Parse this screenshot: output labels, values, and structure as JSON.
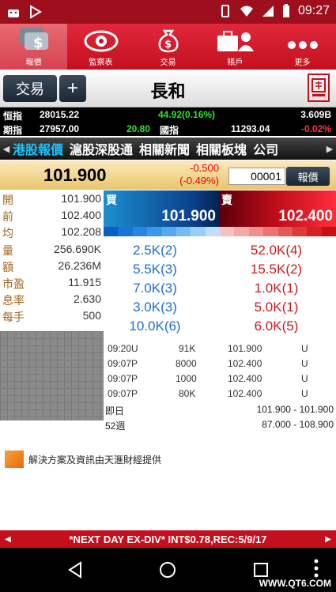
{
  "status": {
    "time": "09:27"
  },
  "nav": [
    {
      "label": "報價",
      "icon": "quote-chat-icon",
      "active": true
    },
    {
      "label": "監察表",
      "icon": "eye-icon",
      "active": false
    },
    {
      "label": "交易",
      "icon": "money-bag-icon",
      "active": false
    },
    {
      "label": "賬戶",
      "icon": "briefcase-user-icon",
      "active": false
    },
    {
      "label": "更多",
      "icon": "more-dots-icon",
      "active": false
    }
  ],
  "titlebar": {
    "trade_button": "交易",
    "add_button": "+",
    "title": "長和"
  },
  "indices": {
    "hsi_label": "恒指",
    "hsi_value": "28015.22",
    "hsi_change": "44.92(0.16%)",
    "hsi_turnover": "3.609B",
    "fut_label": "期指",
    "fut_value": "27957.00",
    "fut_change": "20.80",
    "ent_label": "國指",
    "ent_value": "11293.04",
    "ent_change": "-0.02%"
  },
  "tabs": [
    "港股報價",
    "滬股深股通",
    "相關新聞",
    "相關板塊",
    "公司"
  ],
  "quote": {
    "price": "101.900",
    "change": "-0.500",
    "change_pct": "(-0.49%)",
    "code": "00001",
    "quote_button": "報價"
  },
  "stats": [
    {
      "label": "開",
      "value": "101.900"
    },
    {
      "label": "前",
      "value": "102.400"
    },
    {
      "label": "均",
      "value": "102.208"
    },
    {
      "label": "量",
      "value": "256.690K"
    },
    {
      "label": "額",
      "value": "26.236M"
    },
    {
      "label": "市盈",
      "value": "11.915"
    },
    {
      "label": "息率",
      "value": "2.630"
    },
    {
      "label": "每手",
      "value": "500"
    }
  ],
  "bidask": {
    "bid_label": "買",
    "bid_price": "101.900",
    "ask_label": "賣",
    "ask_price": "102.400"
  },
  "depth_colors": [
    "#0b5fc4",
    "#1a74d6",
    "#2a86e0",
    "#3c97e8",
    "#56a9ef",
    "#74bbf3",
    "#98cef7",
    "#bde0fa",
    "#f5c2c2",
    "#f4a9a9",
    "#f08f8f",
    "#eb7373",
    "#e55656",
    "#de3a3a",
    "#d42222",
    "#c81010"
  ],
  "orders": [
    {
      "bid": "2.5K(2)",
      "ask": "52.0K(4)"
    },
    {
      "bid": "5.5K(3)",
      "ask": "15.5K(2)"
    },
    {
      "bid": "7.0K(3)",
      "ask": "1.0K(1)"
    },
    {
      "bid": "3.0K(3)",
      "ask": "5.0K(1)"
    },
    {
      "bid": "10.0K(6)",
      "ask": "6.0K(5)"
    }
  ],
  "trades": [
    {
      "time": "09:20U",
      "qty": "91K",
      "price": "101.900",
      "flag": "U"
    },
    {
      "time": "09:07P",
      "qty": "8000",
      "price": "102.400",
      "flag": "U"
    },
    {
      "time": "09:07P",
      "qty": "1000",
      "price": "102.400",
      "flag": "U"
    },
    {
      "time": "09:07P",
      "qty": "80K",
      "price": "102.400",
      "flag": "U"
    }
  ],
  "ranges": [
    {
      "label": "即日",
      "value": "101.900 - 101.900"
    },
    {
      "label": "52週",
      "value": "87.000 - 108.900"
    }
  ],
  "provider": "解決方案及資訊由天滙財經提供",
  "ticker": "*NEXT DAY EX-DIV*  INT$0.78,REC:5/9/17",
  "watermark": "WWW.QT6.COM"
}
